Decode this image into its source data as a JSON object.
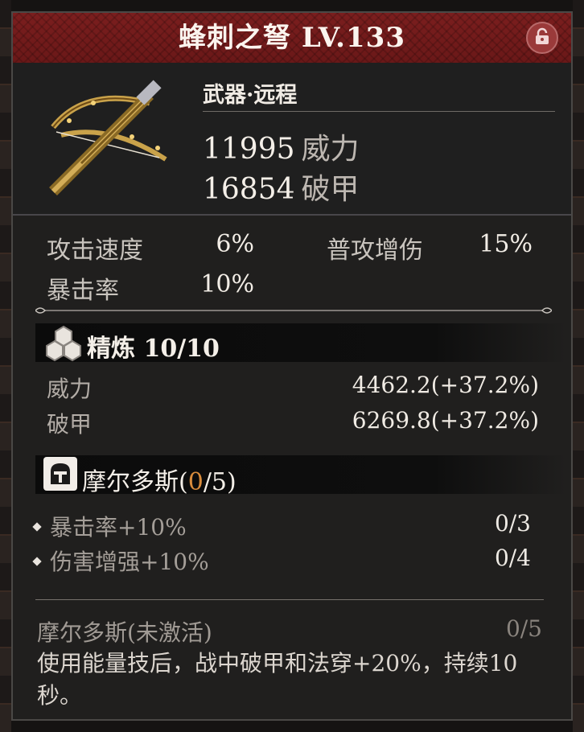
{
  "item": {
    "name": "蜂刺之弩",
    "level": "LV.133",
    "type": "武器·远程",
    "power_value": "11995",
    "power_label": "威力",
    "armor_value": "16854",
    "armor_label": "破甲"
  },
  "attributes": [
    {
      "label": "攻击速度",
      "value": "6%"
    },
    {
      "label": "普攻增伤",
      "value": "15%"
    },
    {
      "label": "暴击率",
      "value": "10%"
    }
  ],
  "refine": {
    "title": "精炼 10/10",
    "rows": [
      {
        "label": "威力",
        "value": "4462.2(+37.2%)"
      },
      {
        "label": "破甲",
        "value": "6269.8(+37.2%)"
      }
    ]
  },
  "set": {
    "name": "摩尔多斯(",
    "current": "0",
    "total": "/5)",
    "bonuses": [
      {
        "label": "暴击率+10%",
        "count": "0/3"
      },
      {
        "label": "伤害增强+10%",
        "count": "0/4"
      }
    ],
    "inactive_title": "摩尔多斯(未激活)",
    "inactive_count": "0/5",
    "description": "使用能量技后，战中破甲和法穿+20%，持续10秒。"
  },
  "colors": {
    "title_bar": "#7b1e1e",
    "panel": "#201f1e",
    "accent_orange": "#d98c3c"
  },
  "icons": [
    "lock-icon",
    "crossbow-weapon-icon",
    "refine-gems-icon",
    "helmet-set-icon",
    "ornament-divider"
  ]
}
